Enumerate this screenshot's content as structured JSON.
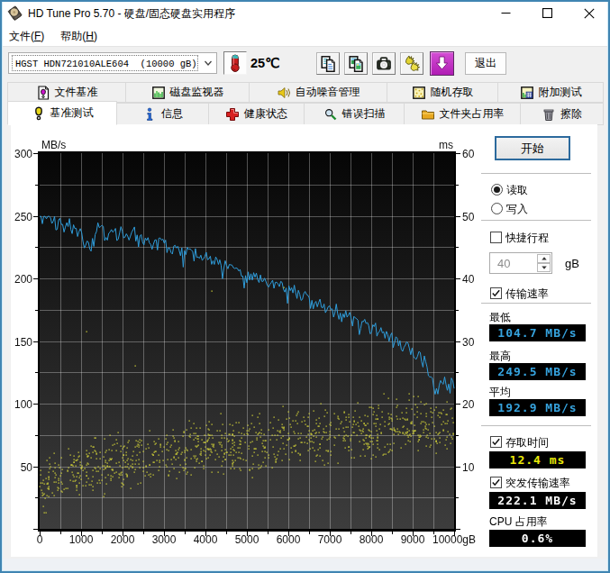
{
  "window": {
    "title": "HD Tune Pro 5.70 - 硬盘/固态硬盘实用程序",
    "controls": {
      "minimize": "–",
      "maximize": "□",
      "close": "×"
    }
  },
  "menu": {
    "items": [
      {
        "pre": "文件(",
        "key": "F",
        "post": ")"
      },
      {
        "pre": "帮助(",
        "key": "H",
        "post": ")"
      }
    ]
  },
  "toolbar": {
    "drive_select": "HGST HDN721010ALE604  (10000 gB)",
    "temperature": "25℃",
    "exit_label": "退出",
    "icons": [
      "copy-text-icon",
      "copy-image-icon",
      "camera-icon",
      "hands-icon",
      "download-icon"
    ]
  },
  "tabs": {
    "row1": [
      {
        "label": "文件基准",
        "icon": "file-benchmark-icon"
      },
      {
        "label": "磁盘监视器",
        "icon": "disk-monitor-icon"
      },
      {
        "label": "自动噪音管理",
        "icon": "aam-icon"
      },
      {
        "label": "随机存取",
        "icon": "random-access-icon"
      },
      {
        "label": "附加测试",
        "icon": "extra-tests-icon"
      }
    ],
    "row2": [
      {
        "label": "基准测试",
        "icon": "benchmark-icon",
        "active": true
      },
      {
        "label": "信息",
        "icon": "info-icon"
      },
      {
        "label": "健康状态",
        "icon": "health-icon"
      },
      {
        "label": "错误扫描",
        "icon": "error-scan-icon"
      },
      {
        "label": "文件夹占用率",
        "icon": "folder-usage-icon"
      },
      {
        "label": "擦除",
        "icon": "erase-icon"
      }
    ]
  },
  "panel": {
    "start_label": "开始",
    "read_label": "读取",
    "write_label": "写入",
    "read_selected": true,
    "shortstroke_label": "快捷行程",
    "shortstroke_checked": false,
    "shortstroke_value": "40",
    "shortstroke_unit": "gB",
    "transfer_label": "传输速率",
    "transfer_checked": true,
    "min_label": "最低",
    "min_value": "104.7 MB/s",
    "max_label": "最高",
    "max_value": "249.5 MB/s",
    "avg_label": "平均",
    "avg_value": "192.9 MB/s",
    "access_label": "存取时间",
    "access_checked": true,
    "access_value": "12.4 ms",
    "burst_label": "突发传输速率",
    "burst_checked": true,
    "burst_value": "222.1 MB/s",
    "cpu_label": "CPU 占用率",
    "cpu_value": "0.6%"
  },
  "chart_data": {
    "type": "line+scatter",
    "title": "",
    "xlabel_unit": "gB",
    "x_ticks": [
      0,
      1000,
      2000,
      3000,
      4000,
      5000,
      6000,
      7000,
      8000,
      9000,
      10000
    ],
    "x_last_label": "10000gB",
    "left_axis": {
      "label": "MB/s",
      "min": 0,
      "max": 300,
      "step": 50,
      "minor_step": 25
    },
    "right_axis": {
      "label": "ms",
      "min": 0,
      "max": 60,
      "step": 10,
      "minor_step": 5
    },
    "series": [
      {
        "name": "transfer_rate",
        "unit": "MB/s",
        "color": "#2f9ddb",
        "style": "line",
        "anchors_x": [
          0,
          200,
          400,
          700,
          1000,
          1200,
          1400,
          1700,
          2000,
          2300,
          2600,
          3000,
          3400,
          3800,
          4200,
          4600,
          5000,
          5400,
          5800,
          6200,
          6600,
          7000,
          7400,
          7800,
          8200,
          8600,
          9000,
          9300,
          9450,
          9550,
          9700,
          9850,
          9950,
          10000
        ],
        "anchors_y": [
          249,
          251,
          245,
          242,
          234,
          225,
          239,
          236,
          235,
          237,
          231,
          228,
          223,
          219,
          215,
          210,
          203,
          199,
          195,
          189,
          182,
          176,
          170,
          164,
          158,
          150,
          140,
          133,
          122,
          107,
          123,
          110,
          118,
          114
        ],
        "noise_amplitude": 6.2,
        "min": 104.7,
        "max": 249.5,
        "avg": 192.9
      },
      {
        "name": "access_time",
        "unit": "ms",
        "color": "#d9d938",
        "style": "dots",
        "count": 1060,
        "curve": "sqrt",
        "base_start_ms": 5.9,
        "base_end_ms": 16.9,
        "spread_ms": 4.1,
        "outliers": [
          [
            1120,
            31.5
          ],
          [
            4160,
            38.0
          ],
          [
            5890,
            38.5
          ],
          [
            2300,
            26.0
          ]
        ],
        "mean_ms": 12.4
      }
    ],
    "plot": {
      "bg_top": "#060606",
      "bg_bottom": "#3d3d3d",
      "grid_color": "rgba(255,255,255,0.30)",
      "frame_color": "#000000"
    }
  }
}
